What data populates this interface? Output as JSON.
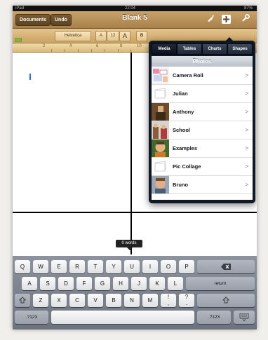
{
  "status_bar": {
    "carrier": "iPad",
    "time": "22:04",
    "battery": "87%"
  },
  "toolbar": {
    "documents_label": "Documents",
    "undo_label": "Undo",
    "title": "Blank 5",
    "icons": [
      "brush-icon",
      "insert-plus-icon",
      "wrench-icon"
    ]
  },
  "format_bar": {
    "font_name": "Helvetica",
    "font_size": "12",
    "small_a": "A",
    "large_a": "A",
    "bold": "B"
  },
  "ruler": {
    "numbers": [
      "2",
      "4",
      "6",
      "8",
      "10"
    ]
  },
  "word_count": "0 words",
  "popover": {
    "tabs": [
      {
        "label": "Media",
        "active": true
      },
      {
        "label": "Tables",
        "active": false
      },
      {
        "label": "Charts",
        "active": false
      },
      {
        "label": "Shapes",
        "active": false
      }
    ],
    "header": "Photos",
    "albums": [
      {
        "label": "Camera Roll",
        "thumb": "collage"
      },
      {
        "label": "Julian",
        "thumb": "empty"
      },
      {
        "label": "Anthony",
        "thumb": "photo"
      },
      {
        "label": "School",
        "thumb": "photo"
      },
      {
        "label": "Examples",
        "thumb": "photo"
      },
      {
        "label": "Pic Collage",
        "thumb": "empty"
      },
      {
        "label": "Bruno",
        "thumb": "photo"
      }
    ]
  },
  "keyboard": {
    "row1": [
      "Q",
      "W",
      "E",
      "R",
      "T",
      "Y",
      "U",
      "I",
      "O",
      "P"
    ],
    "row2": [
      "A",
      "S",
      "D",
      "F",
      "G",
      "H",
      "J",
      "K",
      "L"
    ],
    "row3": [
      "Z",
      "X",
      "C",
      "V",
      "B",
      "N",
      "M"
    ],
    "return_label": "return",
    "numbers_label": ".?123",
    "exclaim_top": "!",
    "exclaim_bottom": ",",
    "question_top": "?",
    "question_bottom": ".",
    "icons": [
      "backspace-icon",
      "shift-icon",
      "hide-keyboard-icon"
    ]
  }
}
